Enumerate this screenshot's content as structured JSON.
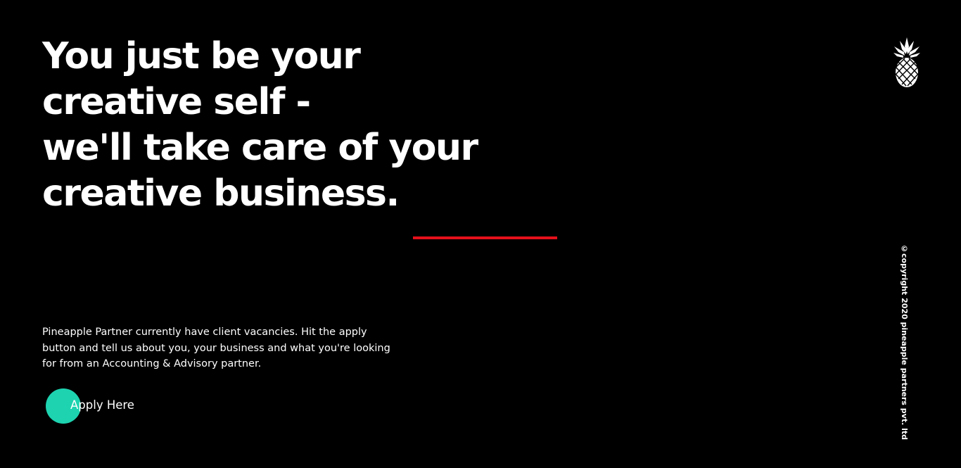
{
  "hero": {
    "headline_lines": [
      "You just be your",
      "creative self -",
      "we'll take care of your",
      "creative business."
    ],
    "intro_text": "Pineapple Partner currently have client vacancies. Hit the apply button and tell us about you, your business and what you're looking for from an Accounting & Advisory partner.",
    "apply_label": "Apply Here"
  },
  "brand": {
    "logo_icon": "pineapple-icon",
    "copyright": "©copyright 2020 pineapple partners pvt. ltd"
  },
  "colors": {
    "background": "#000000",
    "text": "#ffffff",
    "accent_rule": "#e3101b",
    "button_circle": "#1dd3b0"
  }
}
